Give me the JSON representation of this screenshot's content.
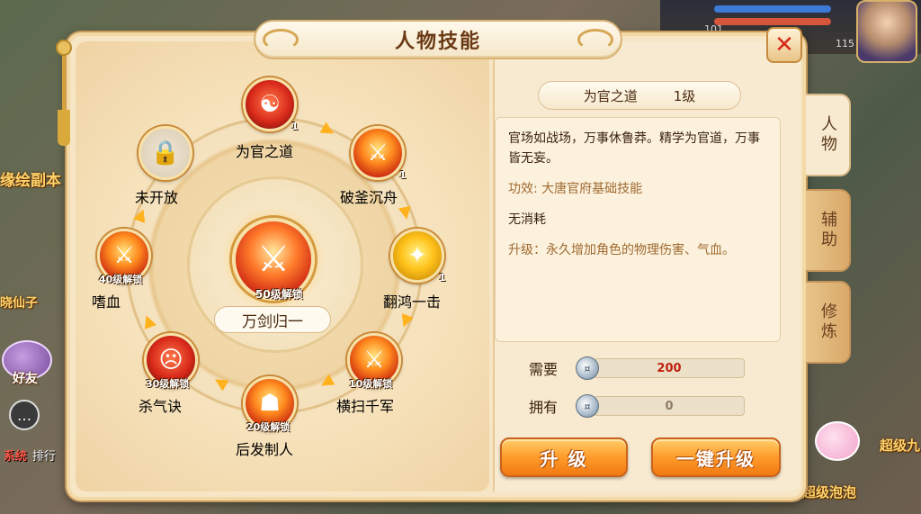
{
  "window": {
    "title": "人物技能"
  },
  "center_skill": {
    "name": "万剑归一",
    "unlock": "50级解锁"
  },
  "skills": [
    {
      "name": "为官之道",
      "level": "1",
      "unlock": "",
      "state": "unlocked",
      "selected": true
    },
    {
      "name": "破釜沉舟",
      "level": "1",
      "unlock": "",
      "state": "unlocked"
    },
    {
      "name": "翻鸿一击",
      "level": "1",
      "unlock": "",
      "state": "unlocked"
    },
    {
      "name": "横扫千军",
      "level": "",
      "unlock": "10级解锁",
      "state": "locked"
    },
    {
      "name": "后发制人",
      "level": "",
      "unlock": "20级解锁",
      "state": "locked"
    },
    {
      "name": "杀气诀",
      "level": "",
      "unlock": "30级解锁",
      "state": "locked"
    },
    {
      "name": "嗜血",
      "level": "",
      "unlock": "40级解锁",
      "state": "locked"
    },
    {
      "name": "未开放",
      "level": "",
      "unlock": "",
      "state": "unavailable"
    }
  ],
  "detail": {
    "skill_name": "为官之道",
    "skill_level": "1级",
    "description": "官场如战场，万事休鲁莽。精学为官道，万事皆无妄。",
    "effect": "功效: 大唐官府基础技能",
    "cost": "无消耗",
    "upgrade": "升级：永久增加角色的物理伤害、气血。"
  },
  "requirement": {
    "need_label": "需要",
    "need_value": "200",
    "have_label": "拥有",
    "have_value": "0"
  },
  "buttons": {
    "upgrade": "升 级",
    "one_click_upgrade": "一键升级"
  },
  "tabs": [
    {
      "label": "人物",
      "active": true
    },
    {
      "label": "辅助",
      "active": false
    },
    {
      "label": "修炼",
      "active": false
    }
  ],
  "background": {
    "left_texts": [
      "缘绘副本",
      "晓仙子",
      "好友"
    ],
    "chat_tag": "系统",
    "chat_text": "排行",
    "right_texts": [
      "超级九",
      "超级泡泡"
    ],
    "hud_level": "115",
    "hud_small": "101"
  },
  "colors": {
    "need_value": "#c0200f",
    "have_value": "#8a7a66",
    "button_orange": "#ff9a2a",
    "close_x": "#d62a1a"
  }
}
